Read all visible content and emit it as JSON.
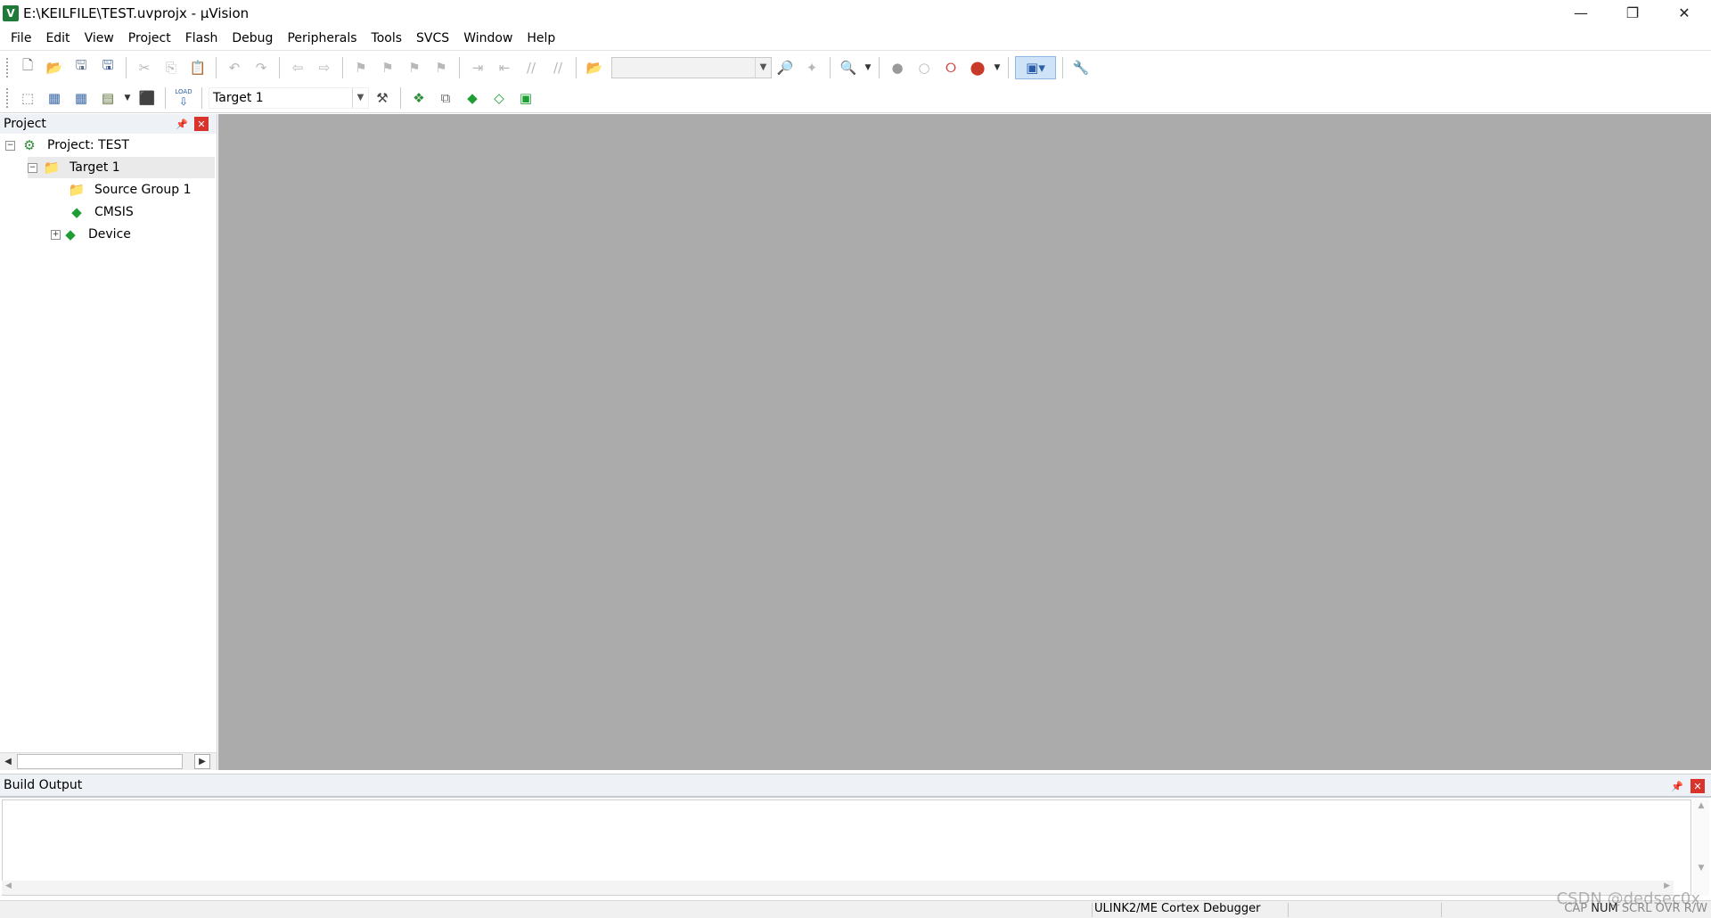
{
  "window": {
    "title": "E:\\KEILFILE\\TEST.uvprojx - µVision",
    "app_icon": "uvision-app-icon",
    "minimize_glyph": "—",
    "restore_glyph": "❐",
    "close_glyph": "✕"
  },
  "menu": [
    "File",
    "Edit",
    "View",
    "Project",
    "Flash",
    "Debug",
    "Peripherals",
    "Tools",
    "SVCS",
    "Window",
    "Help"
  ],
  "toolbar": {
    "find_combo_value": "",
    "target_combo_value": "Target 1",
    "load_label": "LOAD"
  },
  "project_panel": {
    "title": "Project",
    "tree": {
      "root": "Project: TEST",
      "target": "Target 1",
      "group": "Source Group 1",
      "cmsis": "CMSIS",
      "device": "Device"
    }
  },
  "build_output": {
    "title": "Build Output"
  },
  "status": {
    "debugger": "ULINK2/ME Cortex Debugger",
    "cap": "CAP",
    "num": "NUM",
    "scrl": "SCRL",
    "ovr": "OVR",
    "rw": "R/W"
  },
  "watermark": "CSDN @dedsec0x",
  "colors": {
    "editor_background": "#ababab",
    "panel_header": "#eef1f6",
    "close_red": "#d9342b",
    "component_green": "#1e9e35"
  }
}
